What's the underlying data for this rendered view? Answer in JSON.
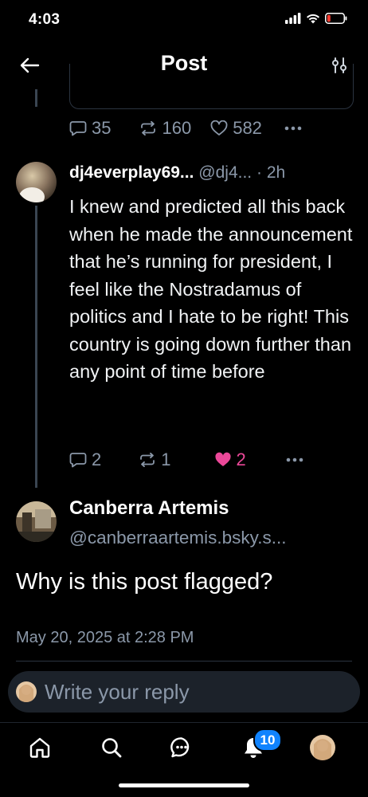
{
  "status_bar": {
    "time": "4:03"
  },
  "header": {
    "title": "Post"
  },
  "parent_post": {
    "actions": {
      "replies": "35",
      "reposts": "160",
      "likes": "582"
    }
  },
  "reply_post": {
    "display_name": "dj4everplay69...",
    "handle": "@dj4...",
    "time_sep": " · ",
    "time": "2h",
    "text": "I knew and predicted all this back when he made the announcement that he’s running for president, I feel like the Nostradamus of politics and I hate to be right! This country is going down further than any point of time before",
    "actions": {
      "replies": "2",
      "reposts": "1",
      "likes": "2"
    }
  },
  "main_post": {
    "display_name": "Canberra Artemis",
    "handle": "@canberraartemis.bsky.s...",
    "text": "Why is this post flagged?",
    "timestamp": "May 20, 2025 at 2:28 PM"
  },
  "composer": {
    "placeholder": "Write your reply"
  },
  "tabbar": {
    "notification_count": "10"
  },
  "colors": {
    "background": "#000000",
    "muted_text": "#8b98a9",
    "like_active": "#ec4899",
    "badge": "#1083fe",
    "battery_low": "#ff3b30"
  }
}
